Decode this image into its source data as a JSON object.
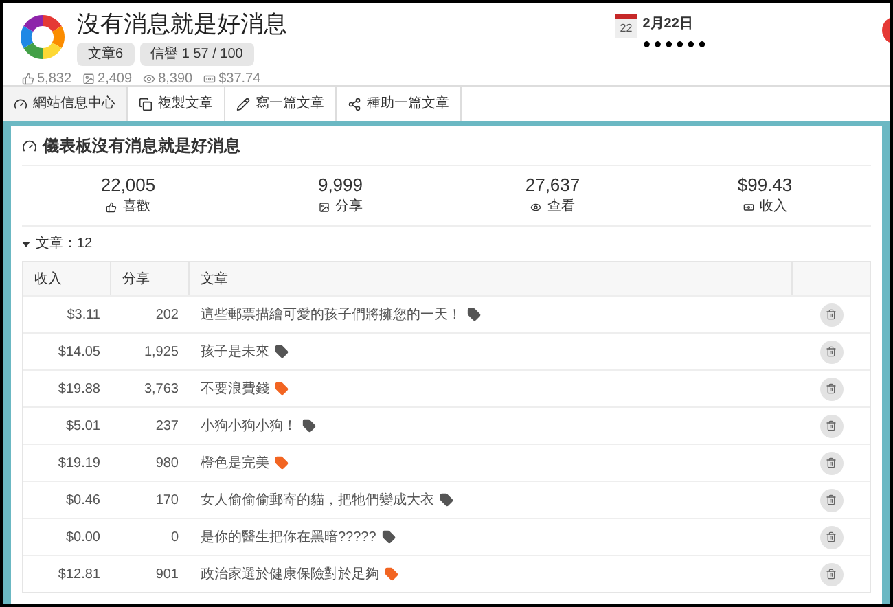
{
  "header": {
    "title": "沒有消息就是好消息",
    "badges": [
      "文章6",
      "信譽 1 57 / 100"
    ],
    "stats": [
      "5,832",
      "2,409",
      "8,390",
      "$37.74"
    ],
    "calendar_day": "22",
    "date": "2月22日",
    "masked": "●●●●●●"
  },
  "tabs": [
    {
      "label": "網站信息中心",
      "selected": true
    },
    {
      "label": "複製文章",
      "selected": false
    },
    {
      "label": "寫一篇文章",
      "selected": false
    },
    {
      "label": "種助一篇文章",
      "selected": false
    }
  ],
  "dashboard": {
    "title": "儀表板沒有消息就是好消息",
    "totals": [
      {
        "value": "22,005",
        "label": "喜歡"
      },
      {
        "value": "9,999",
        "label": "分享"
      },
      {
        "value": "27,637",
        "label": "查看"
      },
      {
        "value": "$99.43",
        "label": "收入"
      }
    ]
  },
  "articles": {
    "summary": "文章：12",
    "expanded": true,
    "columns": [
      "收入",
      "分享",
      "文章"
    ],
    "rows": [
      {
        "income": "$3.11",
        "shares": "202",
        "title": "這些郵票描繪可愛的孩子們將擁您的一天！",
        "color": "#555555"
      },
      {
        "income": "$14.05",
        "shares": "1,925",
        "title": "孩子是未來",
        "color": "#555555"
      },
      {
        "income": "$19.88",
        "shares": "3,763",
        "title": "不要浪費錢",
        "color": "#f26522"
      },
      {
        "income": "$5.01",
        "shares": "237",
        "title": "小狗小狗小狗！",
        "color": "#555555"
      },
      {
        "income": "$19.19",
        "shares": "980",
        "title": "橙色是完美",
        "color": "#f26522"
      },
      {
        "income": "$0.46",
        "shares": "170",
        "title": "女人偷偷偷郵寄的貓，把牠們變成大衣",
        "color": "#555555"
      },
      {
        "income": "$0.00",
        "shares": "0",
        "title": "是你的醫生把你在黑暗?????",
        "color": "#555555"
      },
      {
        "income": "$12.81",
        "shares": "901",
        "title": "政治家選於健康保險對於足夠",
        "color": "#f26522"
      }
    ]
  }
}
